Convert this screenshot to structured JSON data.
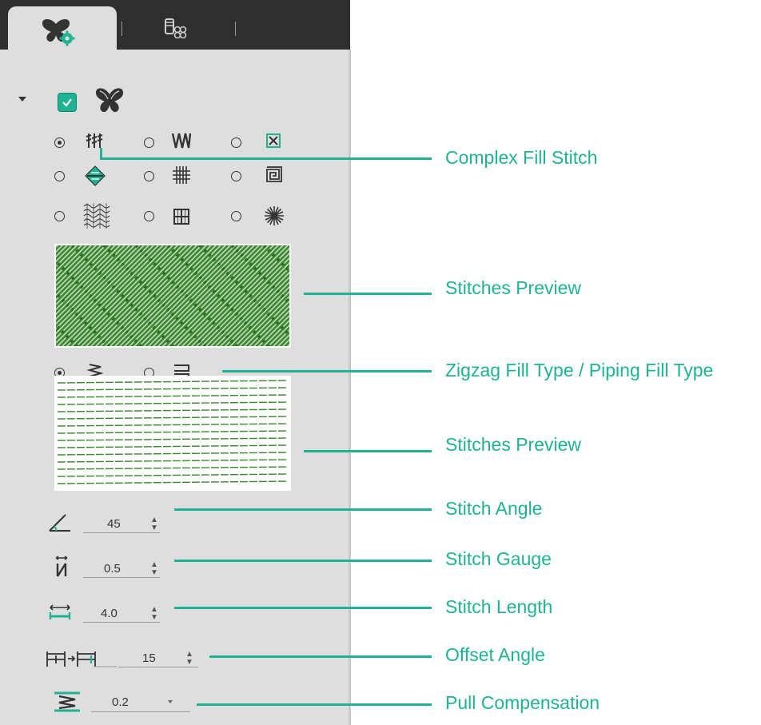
{
  "callouts": {
    "complex_fill": "Complex Fill Stitch",
    "stitches_preview_1": "Stitches Preview",
    "fill_type": "Zigzag Fill Type / Piping Fill Type",
    "stitches_preview_2": "Stitches Preview",
    "stitch_angle": "Stitch Angle",
    "stitch_gauge": "Stitch Gauge",
    "stitch_length": "Stitch Length",
    "offset_angle": "Offset Angle",
    "pull_compensation": "Pull Compensation"
  },
  "fields": {
    "stitch_angle": "45",
    "stitch_gauge": "0.5",
    "stitch_length": "4.0",
    "offset_angle": "15",
    "pull_compensation": "0.2"
  },
  "fill_stitch_options": [
    "complex-fill",
    "zigzag-wave",
    "cross-box",
    "diamond",
    "grid-hash",
    "spiral-square",
    "woven",
    "window-grid",
    "star-burst"
  ],
  "selected_fill_stitch": "complex-fill",
  "fill_type_options": [
    "zigzag-fill",
    "piping-fill"
  ],
  "selected_fill_type": "zigzag-fill",
  "enabled_checkbox": true,
  "colors": {
    "accent": "#1fb394",
    "stitch_green": "#3d8a32",
    "tab_dark": "#2f2f2f",
    "panel": "#dedede"
  }
}
